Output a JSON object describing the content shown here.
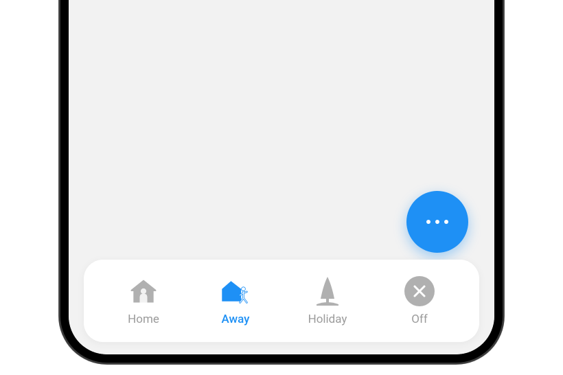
{
  "fab": {
    "name": "more-options"
  },
  "nav": {
    "items": [
      {
        "label": "Home",
        "active": false
      },
      {
        "label": "Away",
        "active": true
      },
      {
        "label": "Holiday",
        "active": false
      },
      {
        "label": "Off",
        "active": false
      }
    ]
  },
  "colors": {
    "accent": "#1e90f5",
    "inactive": "#b0b0b0",
    "background": "#f2f2f2"
  }
}
